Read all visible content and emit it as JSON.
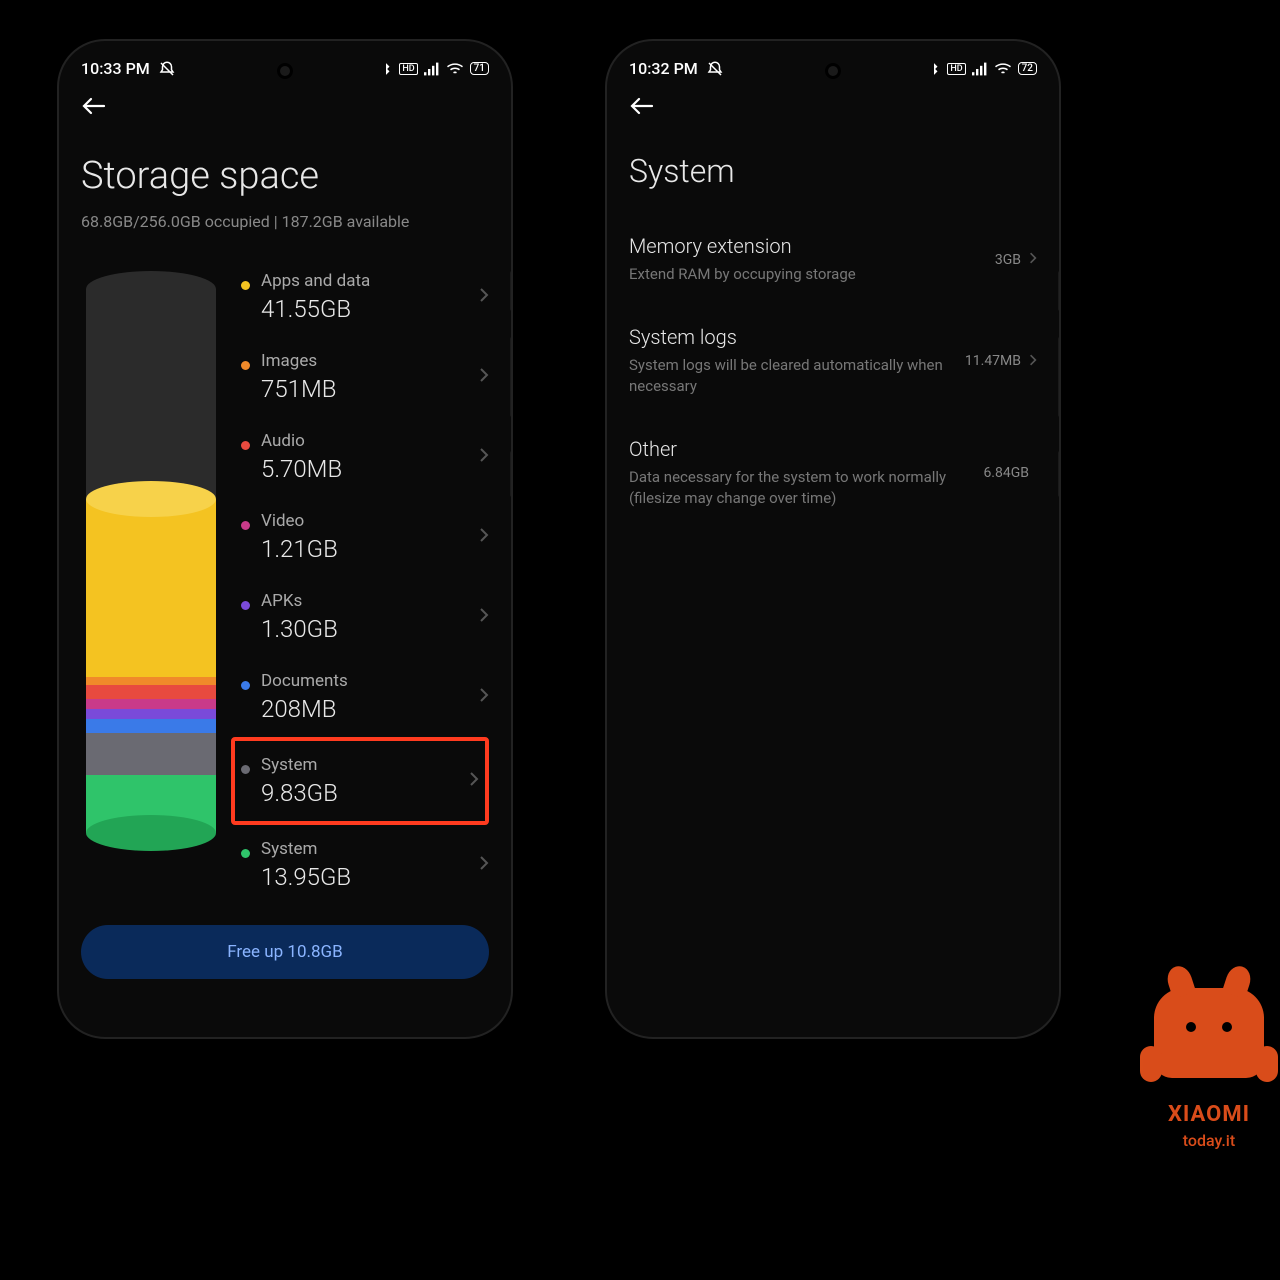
{
  "left": {
    "status": {
      "time": "10:33 PM",
      "battery": "71"
    },
    "title": "Storage space",
    "subtitle": "68.8GB/256.0GB occupied | 187.2GB available",
    "categories": [
      {
        "label": "Apps and data",
        "size": "41.55GB",
        "dot": "dot-yellow"
      },
      {
        "label": "Images",
        "size": "751MB",
        "dot": "dot-orange"
      },
      {
        "label": "Audio",
        "size": "5.70MB",
        "dot": "dot-red"
      },
      {
        "label": "Video",
        "size": "1.21GB",
        "dot": "dot-magenta"
      },
      {
        "label": "APKs",
        "size": "1.30GB",
        "dot": "dot-purple"
      },
      {
        "label": "Documents",
        "size": "208MB",
        "dot": "dot-blue"
      },
      {
        "label": "System",
        "size": "9.83GB",
        "dot": "dot-grey",
        "highlight": true
      },
      {
        "label": "System",
        "size": "13.95GB",
        "dot": "dot-green"
      }
    ],
    "free_button": "Free up 10.8GB"
  },
  "right": {
    "status": {
      "time": "10:32 PM",
      "battery": "72"
    },
    "title": "System",
    "items": [
      {
        "title": "Memory extension",
        "desc": "Extend RAM by occupying storage",
        "value": "3GB",
        "chevron": true
      },
      {
        "title": "System logs",
        "desc": "System logs will be cleared automatically when necessary",
        "value": "11.47MB",
        "chevron": true
      },
      {
        "title": "Other",
        "desc": "Data necessary for the system to work normally (filesize may change over time)",
        "value": "6.84GB",
        "chevron": false
      }
    ]
  },
  "watermark": {
    "line1": "XIAOMI",
    "line2": "today.it"
  },
  "chart_data": {
    "type": "bar",
    "title": "Storage usage breakdown",
    "total_gb": 256.0,
    "used_gb": 68.8,
    "available_gb": 187.2,
    "series": [
      {
        "name": "Apps and data",
        "value_gb": 41.55,
        "color": "#f4c321"
      },
      {
        "name": "Images",
        "value_gb": 0.751,
        "color": "#f08a2a"
      },
      {
        "name": "Audio",
        "value_gb": 0.0057,
        "color": "#e84a3f"
      },
      {
        "name": "Video",
        "value_gb": 1.21,
        "color": "#c93a8a"
      },
      {
        "name": "APKs",
        "value_gb": 1.3,
        "color": "#7a4ad9"
      },
      {
        "name": "Documents",
        "value_gb": 0.208,
        "color": "#3a7ae8"
      },
      {
        "name": "System",
        "value_gb": 9.83,
        "color": "#6a6a72"
      },
      {
        "name": "System",
        "value_gb": 13.95,
        "color": "#2fc46a"
      }
    ]
  }
}
